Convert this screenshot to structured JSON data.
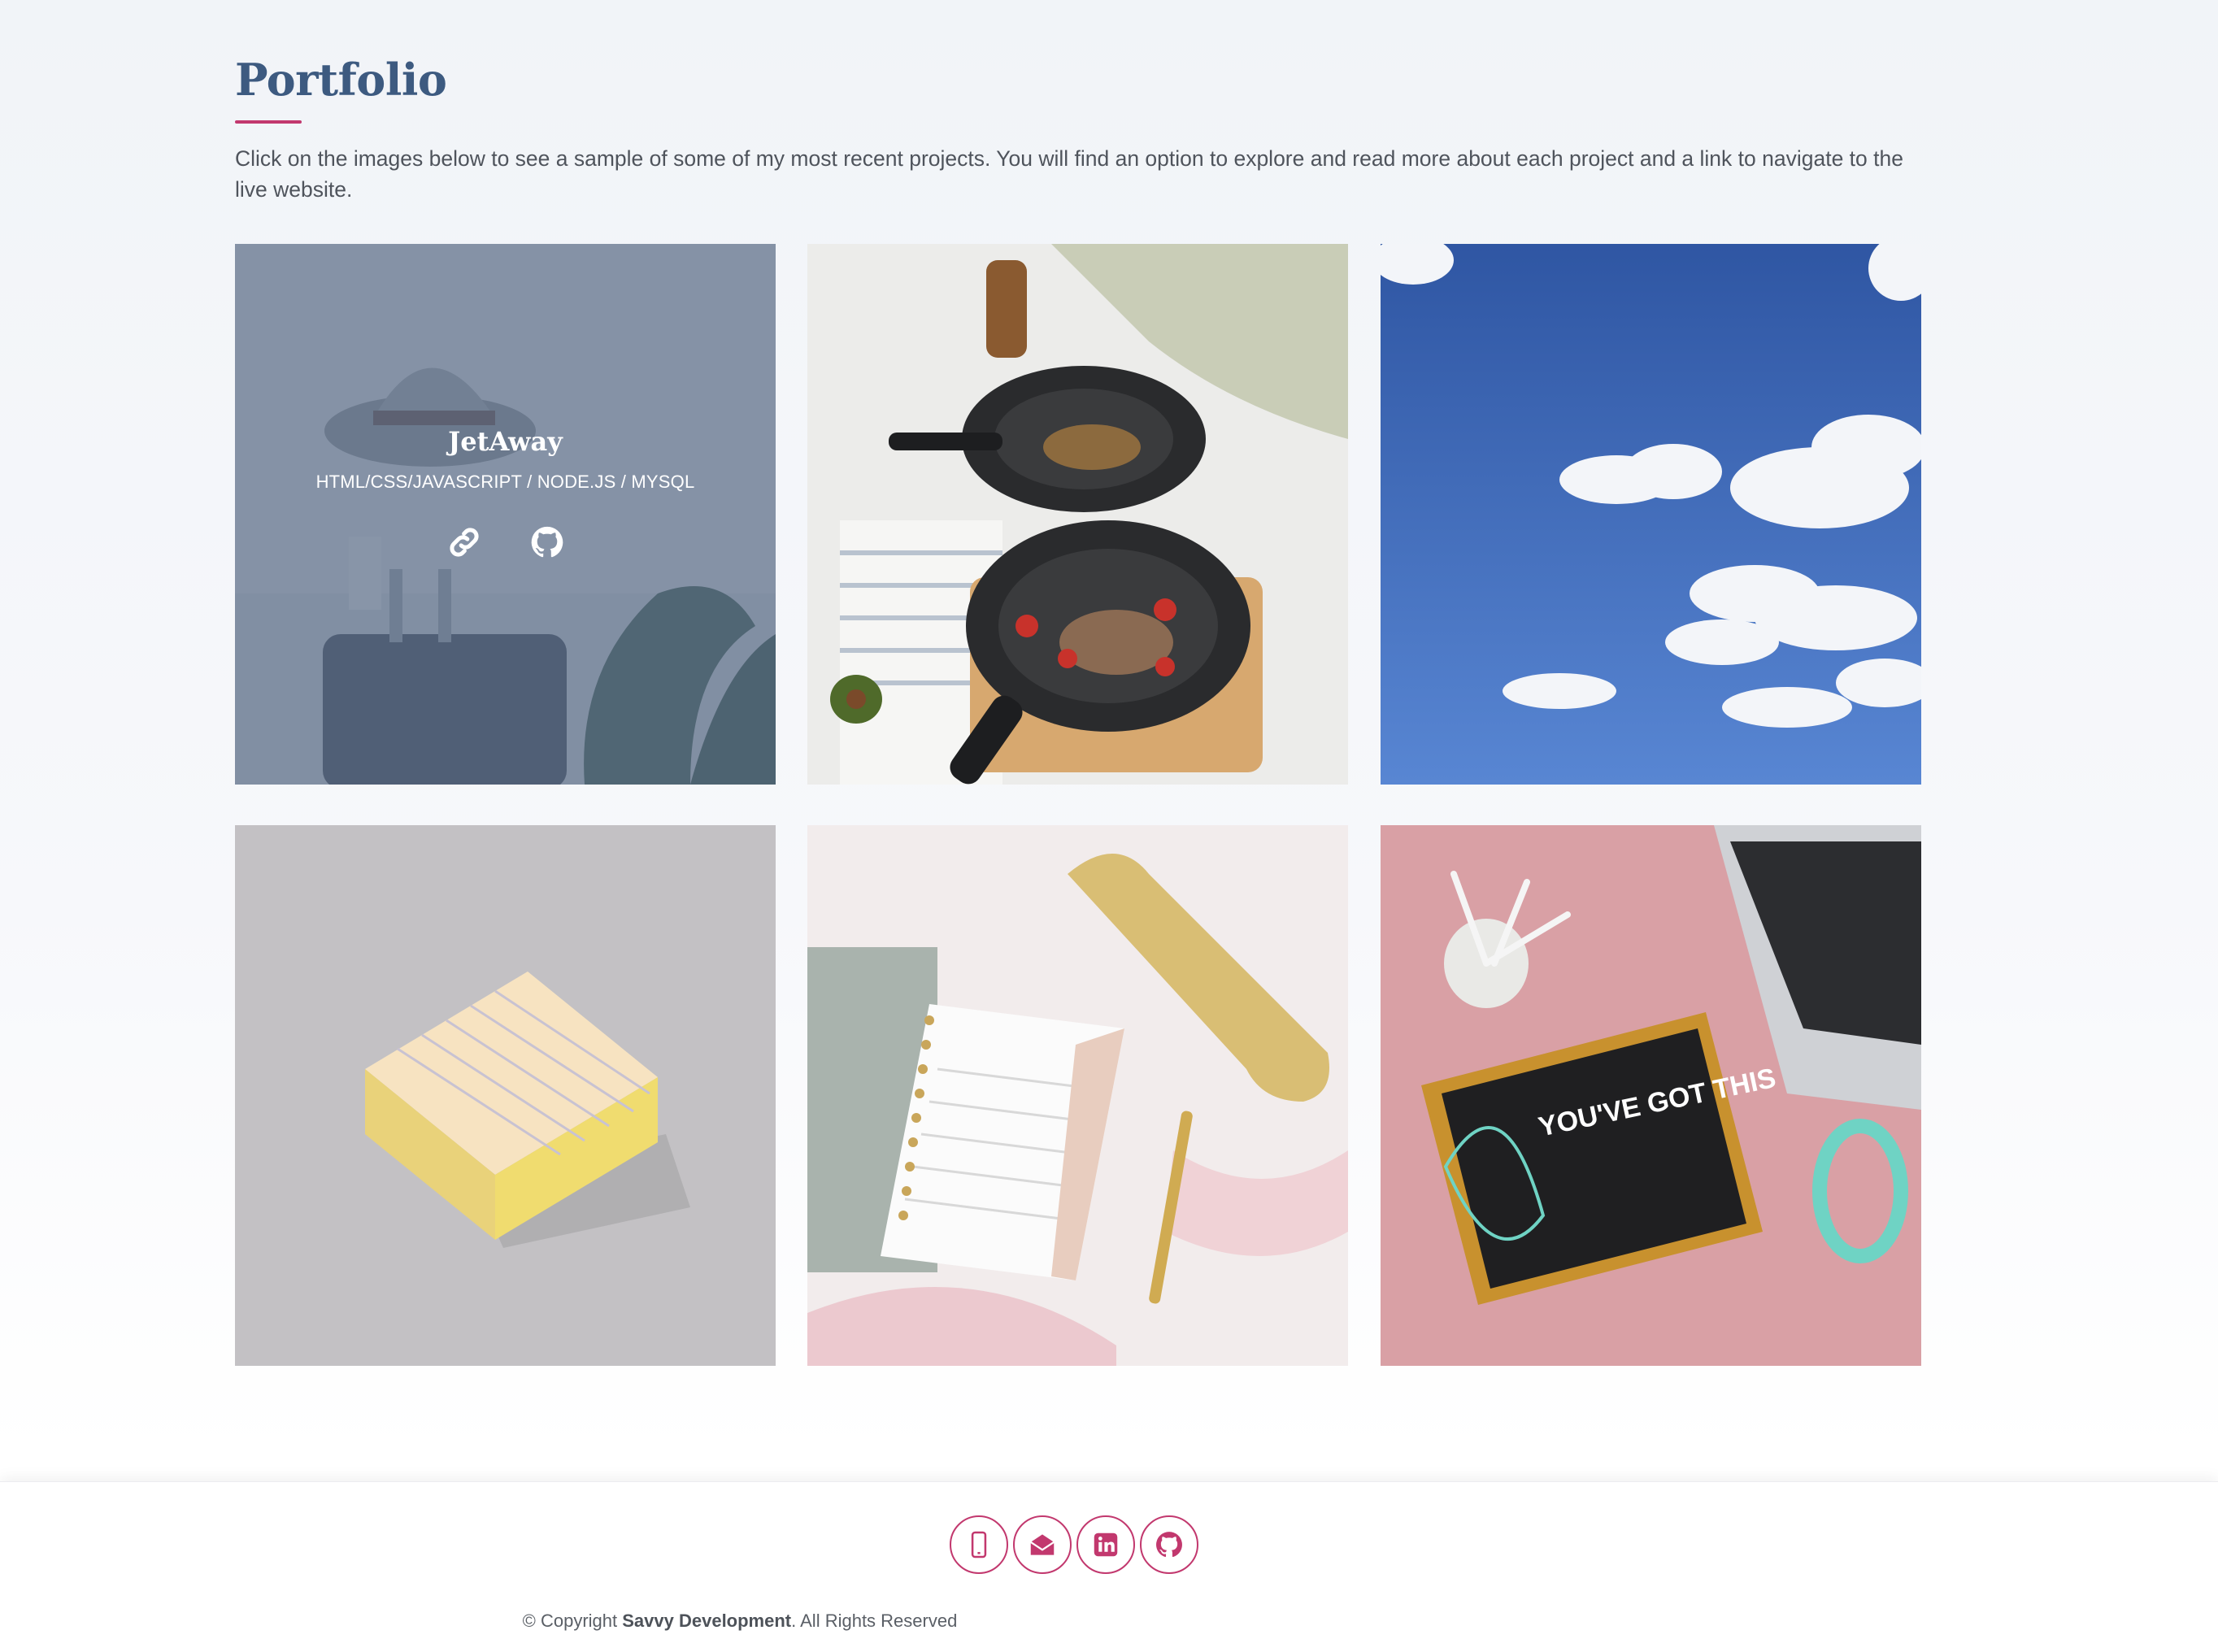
{
  "portfolio": {
    "title": "Portfolio",
    "intro": "Click on the images below to see a sample of some of my most recent projects. You will find an option to explore and read more about each project and a link to navigate to the live website.",
    "projects": [
      {
        "title": "JetAway",
        "tech": "HTML/CSS/JAVASCRIPT / NODE.JS / MYSQL",
        "image": "travel-hat-suitcase-photo",
        "link_icon": "link-icon",
        "repo_icon": "github-icon"
      },
      {
        "image": "cooking-pans-photo"
      },
      {
        "image": "blue-sky-clouds-photo"
      },
      {
        "image": "sticky-note-pad-photo"
      },
      {
        "image": "planner-notebook-photo"
      },
      {
        "image": "you-got-this-letterboard-photo",
        "sign_text": "YOU'VE GOT THIS"
      }
    ]
  },
  "footer": {
    "social_icons": [
      "phone-icon",
      "envelope-icon",
      "linkedin-icon",
      "github-icon"
    ],
    "copyright_prefix": "© Copyright ",
    "copyright_brand": "Savvy Development",
    "copyright_suffix": ". All Rights Reserved"
  },
  "colors": {
    "title": "#3d5a80",
    "accent": "#c2386e",
    "overlay": "#5e708b"
  }
}
